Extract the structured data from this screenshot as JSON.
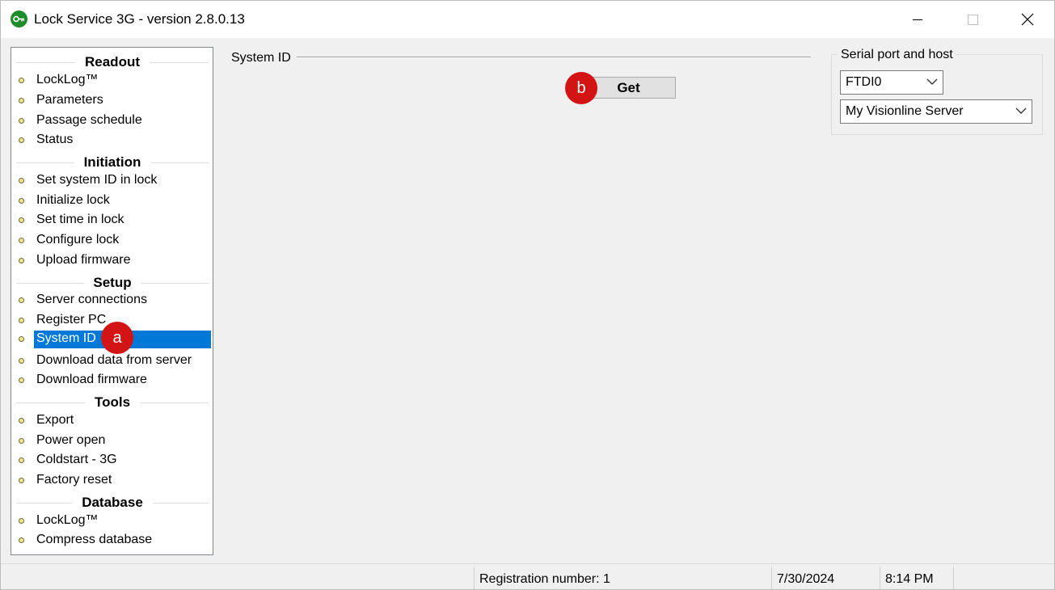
{
  "window": {
    "title": "Lock Service 3G - version 2.8.0.13"
  },
  "nav": {
    "sections": [
      {
        "header": "Readout",
        "items": [
          "LockLog™",
          "Parameters",
          "Passage schedule",
          "Status"
        ]
      },
      {
        "header": "Initiation",
        "items": [
          "Set system ID in lock",
          "Initialize lock",
          "Set time in lock",
          "Configure lock",
          "Upload firmware"
        ]
      },
      {
        "header": "Setup",
        "items": [
          "Server connections",
          "Register PC",
          "System ID",
          "Download data from server",
          "Download firmware"
        ]
      },
      {
        "header": "Tools",
        "items": [
          "Export",
          "Power open",
          "Coldstart - 3G",
          "Factory reset"
        ]
      },
      {
        "header": "Database",
        "items": [
          "LockLog™",
          "Compress database"
        ]
      }
    ],
    "selected_item": "System ID"
  },
  "annotations": {
    "a": "a",
    "b": "b"
  },
  "main": {
    "section_title": "System ID",
    "get_button": "Get"
  },
  "serial": {
    "group_title": "Serial port and host",
    "port_value": "FTDI0",
    "host_value": "My Visionline Server"
  },
  "statusbar": {
    "registration": "Registration number: 1",
    "date": "7/30/2024",
    "time": "8:14 PM"
  },
  "colors": {
    "selection": "#0078d7",
    "badge": "#d21414",
    "app_icon": "#1e8c2a"
  },
  "icons": {
    "app": "key-icon",
    "bullet": "bullet-dot-icon",
    "dropdown": "chevron-down-icon",
    "minimize": "minimize-icon",
    "maximize": "maximize-icon",
    "close": "close-icon"
  }
}
